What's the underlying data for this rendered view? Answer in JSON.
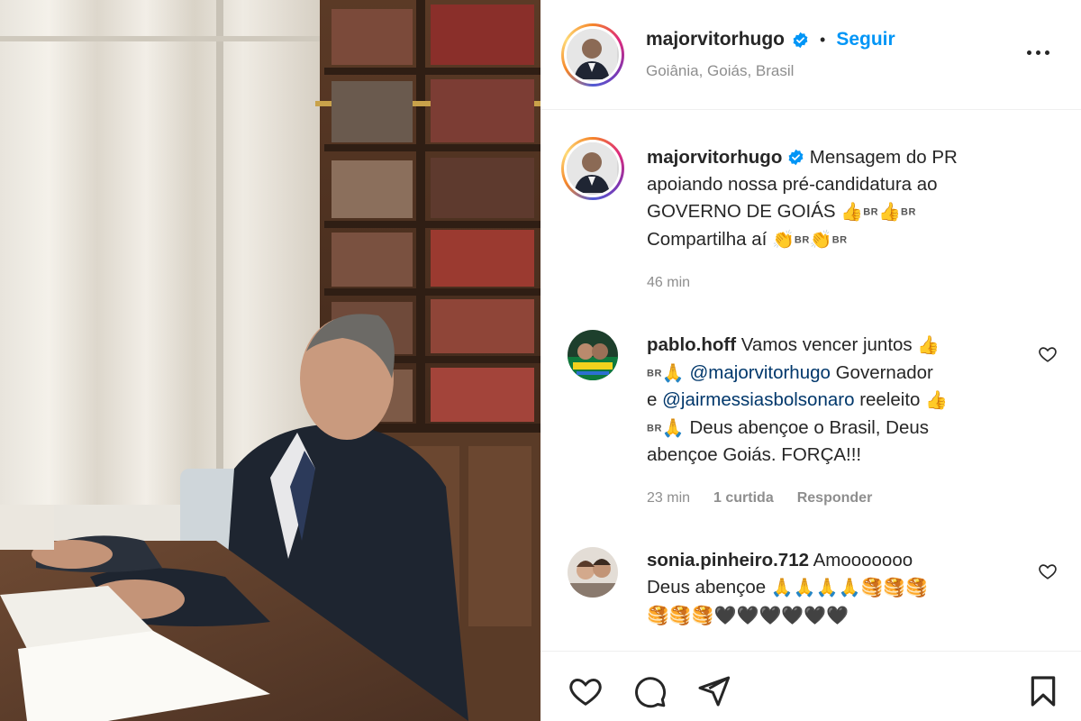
{
  "post": {
    "author": "majorvitorhugo",
    "follow_label": "Seguir",
    "separator": "•",
    "location": "Goiânia, Goiás, Brasil"
  },
  "caption": {
    "username": "majorvitorhugo",
    "line1": "Mensagem do PR",
    "line2": "apoiando nossa pré-candidatura ao",
    "line3": "GOVERNO DE GOIÁS",
    "line4": "Compartilha aí",
    "flag_code": "BR",
    "time": "46 min"
  },
  "comments": [
    {
      "username": "pablo.hoff",
      "text_1": "Vamos vencer juntos",
      "mention_1": "@majorvitorhugo",
      "text_2": "Governador",
      "text_3": "e",
      "mention_2": "@jairmessiasbolsonaro",
      "text_4": "reeleito",
      "text_5": "Deus abençoe o Brasil, Deus",
      "text_6": "abençoe Goiás. FORÇA!!!",
      "time": "23 min",
      "likes": "1 curtida",
      "reply_label": "Responder"
    },
    {
      "username": "sonia.pinheiro.712",
      "text_1": "Amooooooo",
      "text_2": "Deus abençoe"
    }
  ],
  "icons": {
    "verified": "verified-badge-icon",
    "more": "more-options-icon",
    "like": "heart-icon",
    "comment": "comment-icon",
    "share": "send-icon",
    "save": "bookmark-icon"
  },
  "colors": {
    "accent": "#0095f6",
    "text": "#262626",
    "muted": "#8e8e8e",
    "mention": "#00376b"
  }
}
